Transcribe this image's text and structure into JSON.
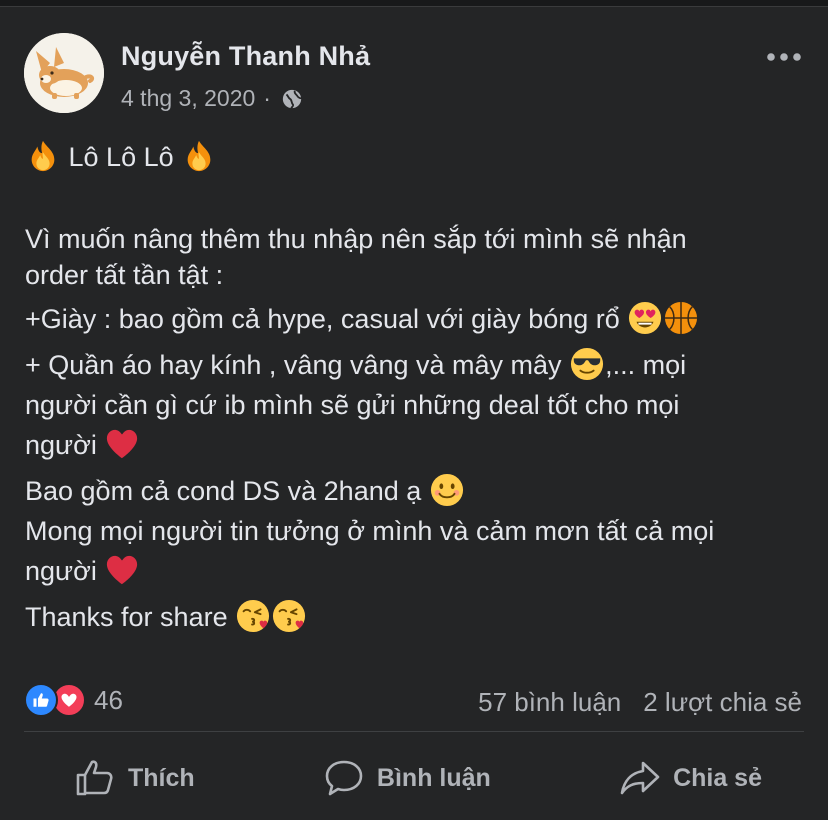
{
  "post": {
    "author": "Nguyễn Thanh Nhả",
    "date": "4 thg 3, 2020",
    "separator": "·",
    "privacy_icon": "globe-icon",
    "more_icon": "more-dots-icon",
    "lines": {
      "l1_a": "Lô Lô Lô",
      "l2": "Vì muốn nâng thêm thu nhập nên sắp tới mình sẽ nhận",
      "l3": "order tất tần tật :",
      "l4": "+Giày : bao gồm cả hype, casual với giày bóng rổ",
      "l5_a": "+ Quần áo hay kính , vâng vâng và mây mây",
      "l5_b": ",... mọi",
      "l6": "người cần gì cứ ib mình sẽ gửi những deal tốt cho mọi",
      "l7": "người",
      "l8": "Bao gồm cả cond DS và 2hand ạ",
      "l9": "Mong mọi người tin tưởng ở mình và cảm mơn tất cả mọi",
      "l10": "người",
      "l11": "Thanks for share"
    },
    "emojis": [
      "fire",
      "fire",
      "heart-eyes",
      "basketball",
      "sunglasses",
      "red-heart",
      "smiling-face",
      "red-heart",
      "kissing-heart",
      "kissing-heart"
    ]
  },
  "stats": {
    "reaction_icons": [
      "like-icon",
      "love-icon"
    ],
    "reaction_count": "46",
    "comments": "57 bình luận",
    "shares": "2 lượt chia sẻ"
  },
  "actions": {
    "like": "Thích",
    "comment": "Bình luận",
    "share": "Chia sẻ"
  },
  "colors": {
    "background": "#242526",
    "page": "#18191a",
    "text": "#e4e6eb",
    "secondary": "#b0b3b8",
    "like_blue": "#2d88ff",
    "love_red": "#f33e58"
  }
}
